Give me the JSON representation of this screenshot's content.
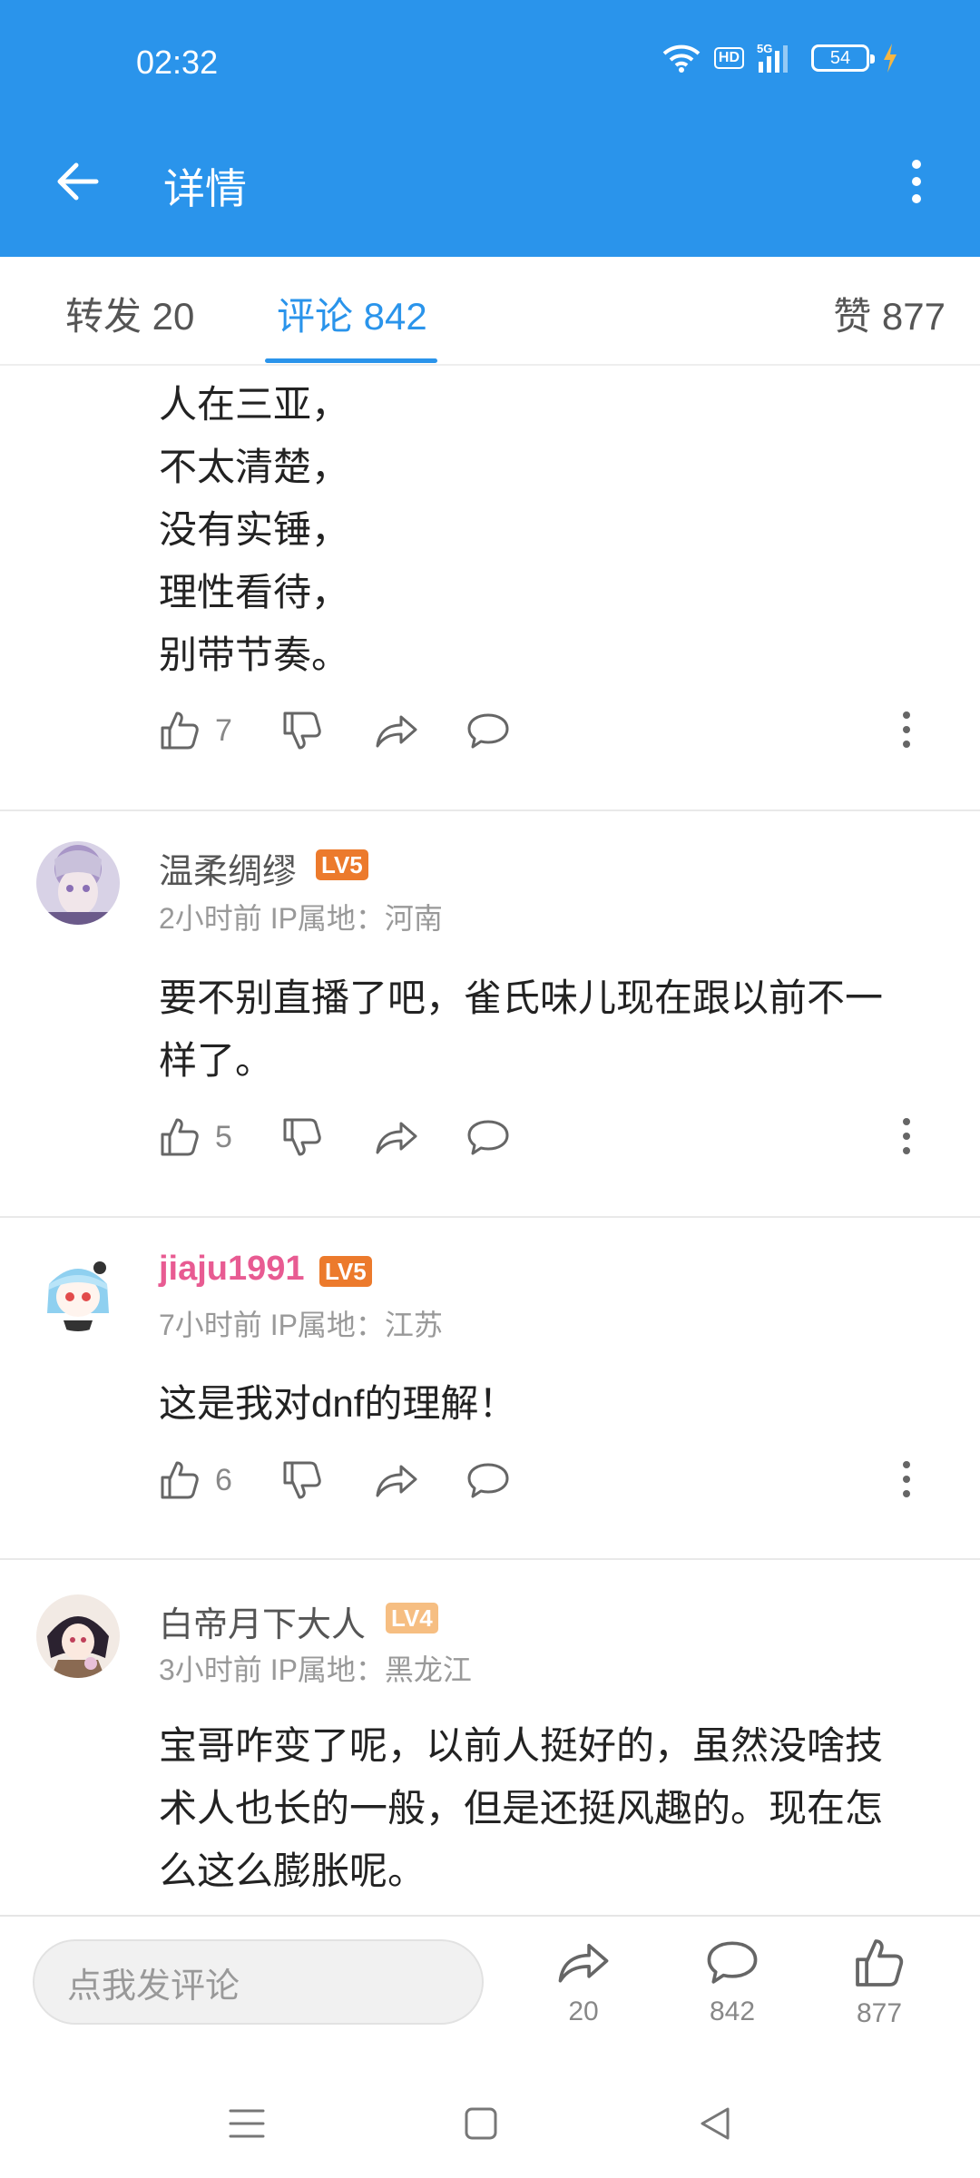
{
  "status_bar": {
    "time": "02:32",
    "hd_label": "HD",
    "network_label": "5G",
    "battery": "54"
  },
  "app_bar": {
    "title": "详情",
    "back_icon": "arrow-left-icon",
    "more_icon": "more-vertical-icon"
  },
  "tabs": [
    {
      "label": "转发 20",
      "active": false
    },
    {
      "label": "评论 842",
      "active": true
    },
    {
      "label": "赞 877",
      "active": false
    }
  ],
  "comments": [
    {
      "text_lines": [
        "人在三亚，",
        "不太清楚，",
        "没有实锤，",
        "理性看待，",
        "别带节奏。"
      ],
      "likes": "7"
    },
    {
      "username": "温柔绸缪",
      "level": "LV5",
      "meta": "2小时前  IP属地：河南",
      "text_lines": [
        "要不别直播了吧，雀氏味儿现在跟以前不一",
        "样了。"
      ],
      "likes": "5"
    },
    {
      "username": "jiaju1991",
      "level": "LV5",
      "meta": "7小时前  IP属地：江苏",
      "text_lines": [
        "这是我对dnf的理解！"
      ],
      "likes": "6"
    },
    {
      "username": "白帝月下大人",
      "level": "LV4",
      "meta": "3小时前  IP属地：黑龙江",
      "text_lines": [
        "宝哥咋变了呢，以前人挺好的，虽然没啥技",
        "术人也长的一般，但是还挺风趣的。现在怎",
        "么这么膨胀呢。"
      ]
    }
  ],
  "bottom_bar": {
    "input_placeholder": "点我发评论",
    "share_count": "20",
    "comment_count": "842",
    "like_count": "877"
  },
  "colors": {
    "primary": "#2a94eb",
    "lv5_badge": "#ec7a2c",
    "lv4_badge": "#f6be82",
    "pink_username": "#e85b92"
  }
}
